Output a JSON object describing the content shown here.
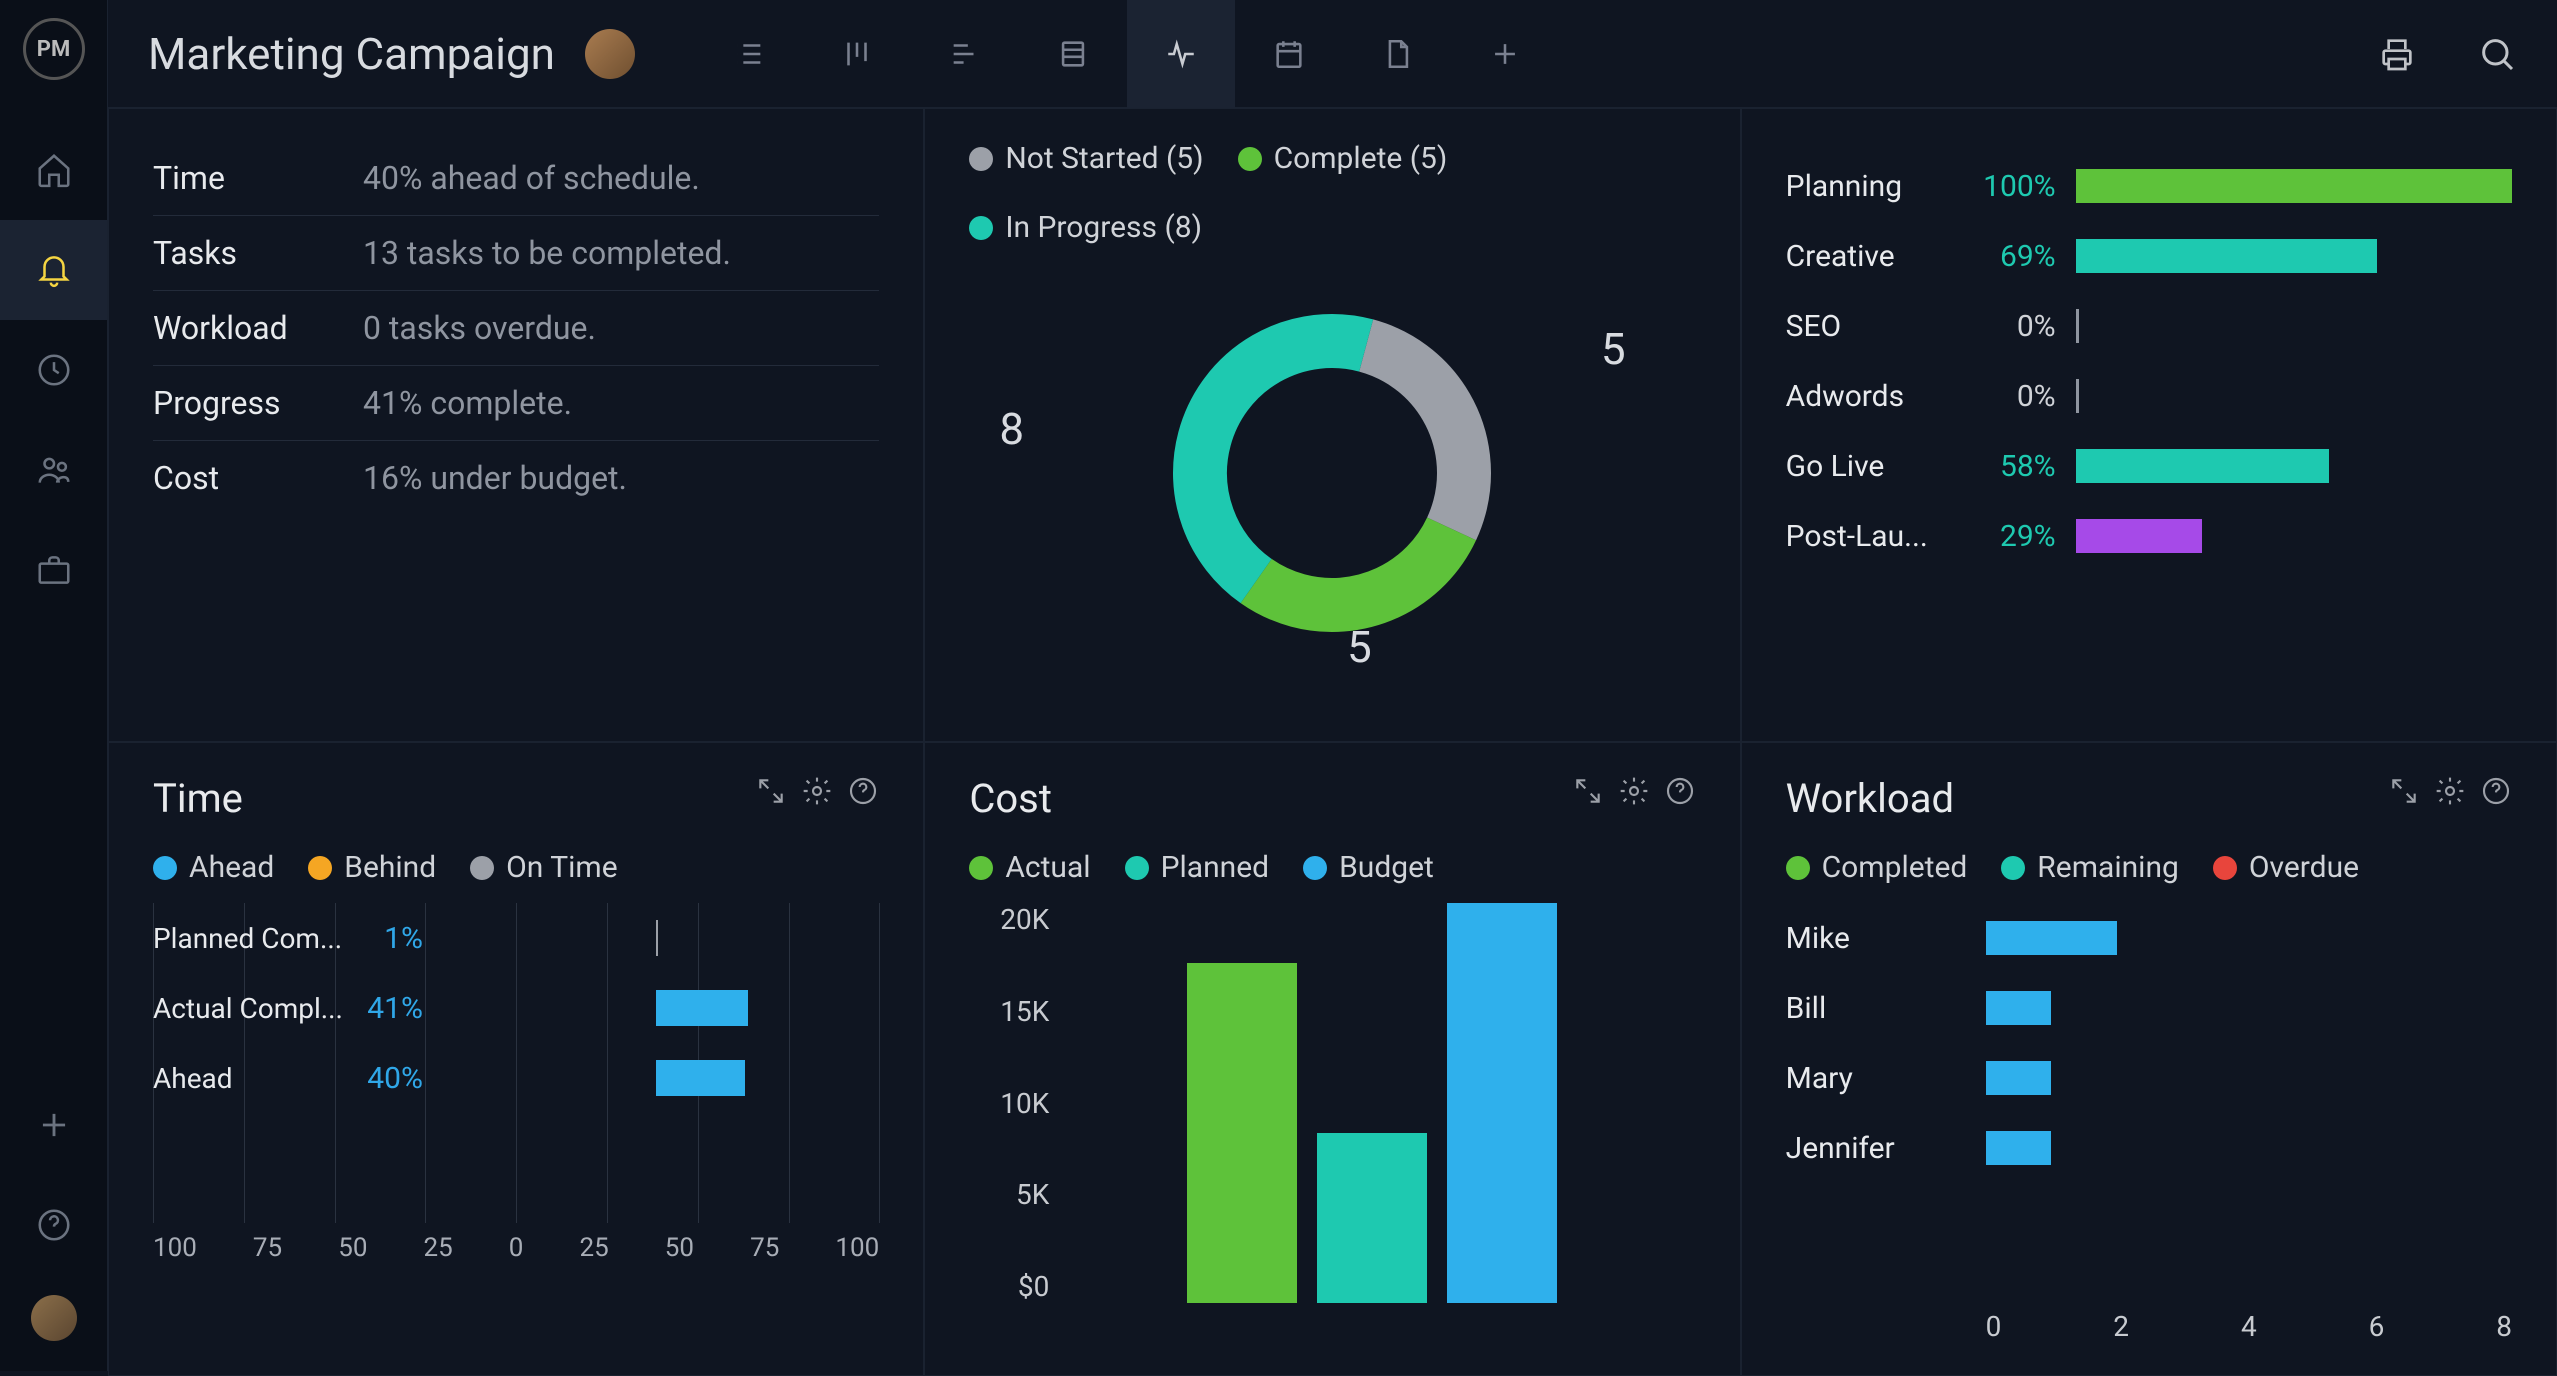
{
  "app": {
    "logo_text": "PM",
    "title": "Marketing Campaign"
  },
  "colors": {
    "green": "#5ec23a",
    "teal": "#1ec9b0",
    "grey": "#9ca0a8",
    "blue": "#2fb0ec",
    "orange": "#f5a623",
    "purple": "#a64ae8",
    "red": "#e8453c"
  },
  "summary": {
    "rows": [
      {
        "label": "Time",
        "value": "40% ahead of schedule."
      },
      {
        "label": "Tasks",
        "value": "13 tasks to be completed."
      },
      {
        "label": "Workload",
        "value": "0 tasks overdue."
      },
      {
        "label": "Progress",
        "value": "41% complete."
      },
      {
        "label": "Cost",
        "value": "16% under budget."
      }
    ]
  },
  "status_donut": {
    "legend": [
      {
        "label": "Not Started (5)",
        "color": "#9ca0a8"
      },
      {
        "label": "Complete (5)",
        "color": "#5ec23a"
      },
      {
        "label": "In Progress (8)",
        "color": "#1ec9b0"
      }
    ],
    "labels": {
      "not_started": "5",
      "complete": "5",
      "in_progress": "8"
    }
  },
  "phase_progress": {
    "rows": [
      {
        "label": "Planning",
        "pct": "100%",
        "pct_val": 100,
        "color": "#5ec23a"
      },
      {
        "label": "Creative",
        "pct": "69%",
        "pct_val": 69,
        "color": "#1ec9b0"
      },
      {
        "label": "SEO",
        "pct": "0%",
        "pct_val": 0,
        "color": "#9ca0a8"
      },
      {
        "label": "Adwords",
        "pct": "0%",
        "pct_val": 0,
        "color": "#9ca0a8"
      },
      {
        "label": "Go Live",
        "pct": "58%",
        "pct_val": 58,
        "color": "#1ec9b0"
      },
      {
        "label": "Post-Lau...",
        "pct": "29%",
        "pct_val": 29,
        "color": "#a64ae8"
      }
    ]
  },
  "time_panel": {
    "title": "Time",
    "legend": [
      {
        "label": "Ahead",
        "color": "#2fb0ec"
      },
      {
        "label": "Behind",
        "color": "#f5a623"
      },
      {
        "label": "On Time",
        "color": "#9ca0a8"
      }
    ],
    "axis": [
      "100",
      "75",
      "50",
      "25",
      "0",
      "25",
      "50",
      "75",
      "100"
    ],
    "rows": [
      {
        "label": "Planned Com...",
        "pct": "1%",
        "val": 1,
        "color": "#9ca0a8"
      },
      {
        "label": "Actual Compl...",
        "pct": "41%",
        "val": 41,
        "color": "#2fb0ec"
      },
      {
        "label": "Ahead",
        "pct": "40%",
        "val": 40,
        "color": "#2fb0ec"
      }
    ]
  },
  "cost_panel": {
    "title": "Cost",
    "legend": [
      {
        "label": "Actual",
        "color": "#5ec23a"
      },
      {
        "label": "Planned",
        "color": "#1ec9b0"
      },
      {
        "label": "Budget",
        "color": "#2fb0ec"
      }
    ],
    "yaxis": [
      "20K",
      "15K",
      "10K",
      "5K",
      "$0"
    ],
    "bars": [
      {
        "name": "Actual",
        "val": 17000,
        "color": "#5ec23a"
      },
      {
        "name": "Planned",
        "val": 8500,
        "color": "#1ec9b0"
      },
      {
        "name": "Budget",
        "val": 20000,
        "color": "#2fb0ec"
      }
    ],
    "ymax": 20000
  },
  "workload_panel": {
    "title": "Workload",
    "legend": [
      {
        "label": "Completed",
        "color": "#5ec23a"
      },
      {
        "label": "Remaining",
        "color": "#1ec9b0"
      },
      {
        "label": "Overdue",
        "color": "#e8453c"
      }
    ],
    "xaxis": [
      "0",
      "2",
      "4",
      "6",
      "8"
    ],
    "xmax": 8,
    "rows": [
      {
        "label": "Mike",
        "val": 2.0
      },
      {
        "label": "Bill",
        "val": 1.0
      },
      {
        "label": "Mary",
        "val": 1.0
      },
      {
        "label": "Jennifer",
        "val": 1.0
      }
    ]
  },
  "chart_data": [
    {
      "type": "pie",
      "title": "Task Status",
      "series": [
        {
          "name": "Not Started",
          "value": 5
        },
        {
          "name": "Complete",
          "value": 5
        },
        {
          "name": "In Progress",
          "value": 8
        }
      ]
    },
    {
      "type": "bar",
      "title": "Phase Progress (%)",
      "categories": [
        "Planning",
        "Creative",
        "SEO",
        "Adwords",
        "Go Live",
        "Post-Launch"
      ],
      "values": [
        100,
        69,
        0,
        0,
        58,
        29
      ],
      "ylim": [
        0,
        100
      ]
    },
    {
      "type": "bar",
      "title": "Time",
      "categories": [
        "Planned Completion",
        "Actual Completion",
        "Ahead"
      ],
      "values": [
        1,
        41,
        40
      ],
      "xlabel": "",
      "ylabel": "%",
      "xlim": [
        -100,
        100
      ]
    },
    {
      "type": "bar",
      "title": "Cost",
      "categories": [
        "Actual",
        "Planned",
        "Budget"
      ],
      "values": [
        17000,
        8500,
        20000
      ],
      "ylabel": "$",
      "ylim": [
        0,
        20000
      ]
    },
    {
      "type": "bar",
      "title": "Workload",
      "categories": [
        "Mike",
        "Bill",
        "Mary",
        "Jennifer"
      ],
      "values": [
        2,
        1,
        1,
        1
      ],
      "xlim": [
        0,
        8
      ]
    }
  ]
}
